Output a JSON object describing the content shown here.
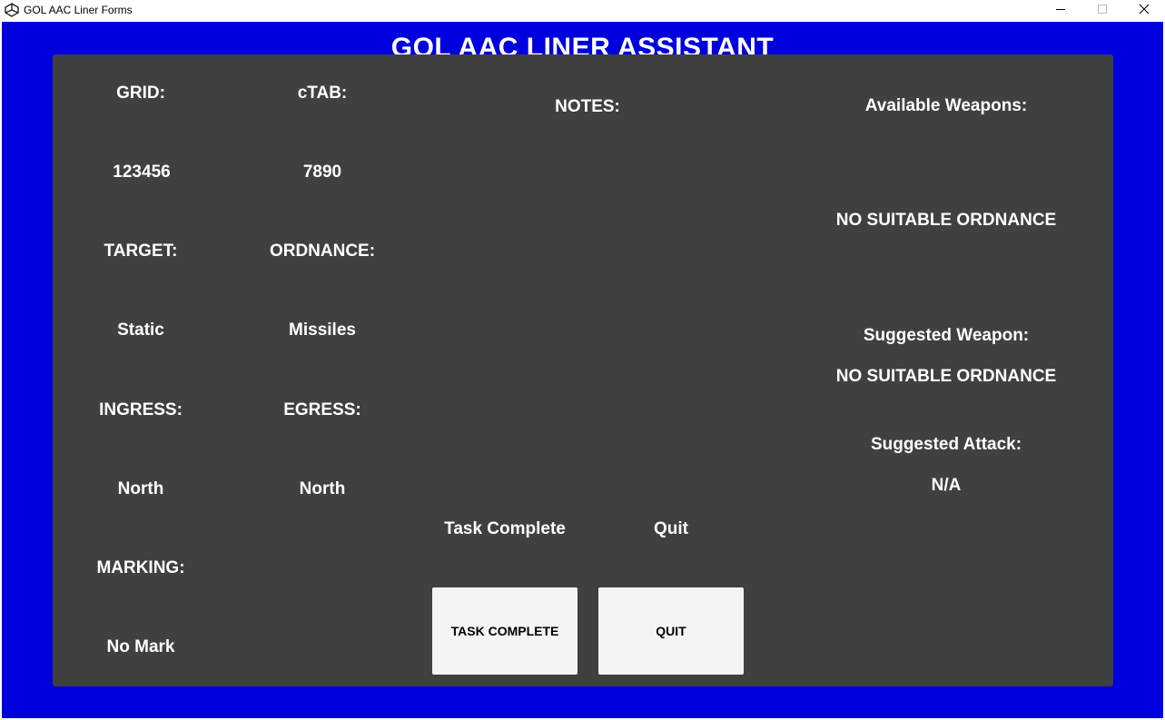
{
  "window": {
    "title": "GOL AAC Liner Forms",
    "minimize_icon": "minimize-icon",
    "maximize_icon": "maximize-icon",
    "close_icon": "close-icon",
    "app_icon": "unity-logo-icon"
  },
  "app": {
    "title": "GOL AAC LINER ASSISTANT",
    "background_color": "#0000de",
    "panel_color": "#404040"
  },
  "form": {
    "grid_label": "GRID:",
    "grid_value": "123456",
    "ctab_label": "cTAB:",
    "ctab_value": "7890",
    "target_label": "TARGET:",
    "target_value": "Static",
    "ordnance_label": "ORDNANCE:",
    "ordnance_value": "Missiles",
    "ingress_label": "INGRESS:",
    "ingress_value": "North",
    "egress_label": "EGRESS:",
    "egress_value": "North",
    "marking_label": "MARKING:",
    "marking_value": "No Mark"
  },
  "notes": {
    "label": "NOTES:"
  },
  "actions": {
    "task_complete_label": "Task Complete",
    "quit_label": "Quit",
    "task_complete_button": "TASK COMPLETE",
    "quit_button": "QUIT"
  },
  "weapons": {
    "available_label": "Available Weapons:",
    "available_value": "NO SUITABLE ORDNANCE",
    "suggested_weapon_label": "Suggested Weapon:",
    "suggested_weapon_value": "NO SUITABLE ORDNANCE",
    "suggested_attack_label": "Suggested Attack:",
    "suggested_attack_value": "N/A"
  }
}
